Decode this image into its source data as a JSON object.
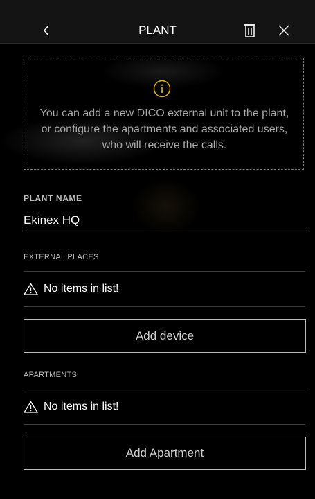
{
  "header": {
    "title": "PLANT",
    "back_icon": "chevron-left-icon",
    "delete_icon": "trash-icon",
    "close_icon": "close-icon"
  },
  "info": {
    "icon": "info-icon",
    "text": "You can add a new DICO external unit to the plant, or configure the apartments and associated users, who will receive the calls."
  },
  "plant_name": {
    "label": "PLANT NAME",
    "value": "Ekinex HQ"
  },
  "external_places": {
    "label": "EXTERNAL PLACES",
    "empty_text": "No items in list!",
    "button_label": "Add device"
  },
  "apartments": {
    "label": "APARTMENTS",
    "empty_text": "No items in list!",
    "button_label": "Add Apartment"
  },
  "colors": {
    "background": "#000000",
    "header": "#141414",
    "accent_info": "#e3b21a",
    "text_muted": "#a8a8a8",
    "border": "#bdbdbd"
  }
}
